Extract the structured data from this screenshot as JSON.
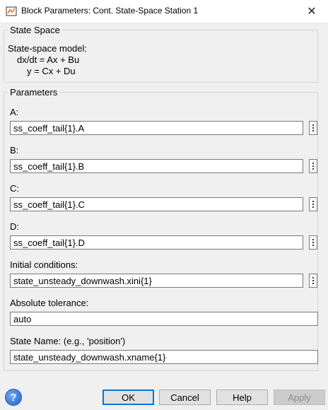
{
  "window": {
    "title": "Block Parameters: Cont. State-Space Station 1",
    "close_glyph": "✕"
  },
  "state_space": {
    "legend": "State Space",
    "description": "State-space model:",
    "equation1": "dx/dt = Ax + Bu",
    "equation2": "y = Cx + Du"
  },
  "parameters": {
    "legend": "Parameters",
    "fields": [
      {
        "label": "A:",
        "value": "ss_coeff_tail{1}.A"
      },
      {
        "label": "B:",
        "value": "ss_coeff_tail{1}.B"
      },
      {
        "label": "C:",
        "value": "ss_coeff_tail{1}.C"
      },
      {
        "label": "D:",
        "value": "ss_coeff_tail{1}.D"
      },
      {
        "label": "Initial conditions:",
        "value": "state_unsteady_downwash.xini{1}"
      },
      {
        "label": "Absolute tolerance:",
        "value": "auto"
      },
      {
        "label": "State Name: (e.g., 'position')",
        "value": "state_unsteady_downwash.xname{1}"
      }
    ]
  },
  "buttons": {
    "help_icon": "?",
    "ok": "OK",
    "cancel": "Cancel",
    "help": "Help",
    "apply": "Apply"
  },
  "colors": {
    "accent": "#0078d7",
    "background": "#f0f0f0"
  }
}
